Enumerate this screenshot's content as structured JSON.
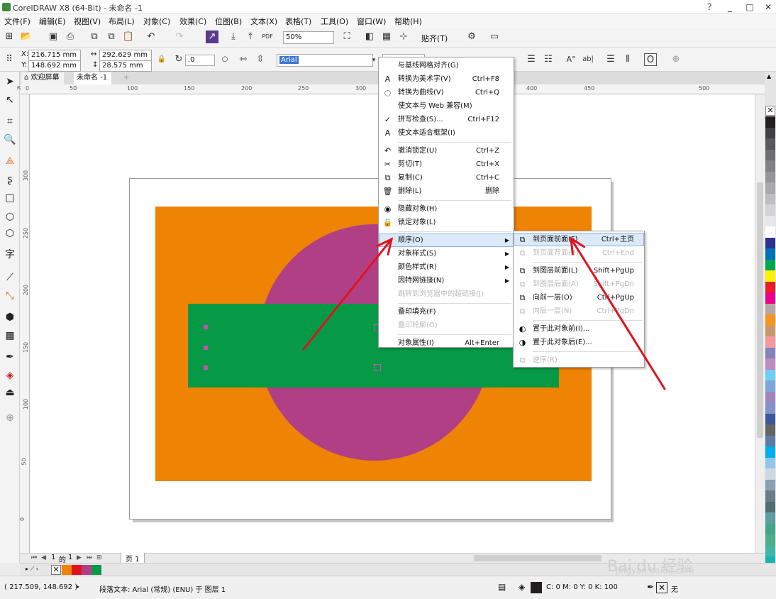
{
  "window": {
    "title": "CorelDRAW X8 (64-Bit) - 未命名 -1",
    "controls": [
      "？",
      "_",
      "□",
      "✕"
    ]
  },
  "menu": [
    "文件(F)",
    "编辑(E)",
    "视图(V)",
    "布局(L)",
    "对象(C)",
    "效果(C)",
    "位图(B)",
    "文本(X)",
    "表格(T)",
    "工具(O)",
    "窗口(W)",
    "帮助(H)"
  ],
  "toolbar": {
    "zoom": "50%",
    "snap_label": "贴齐(T)"
  },
  "propbar": {
    "x_label": "X:",
    "x_value": "216.715 mm",
    "y_label": "Y:",
    "y_value": "148.692 mm",
    "width_value": "292.629 mm",
    "height_value": "28.575 mm",
    "rotation_value": ".0",
    "font_value": "Arial"
  },
  "doc_tabs": [
    "欢迎屏幕",
    "未命名 -1"
  ],
  "ruler_h": [
    "0",
    "50",
    "100",
    "150",
    "200",
    "250",
    "300",
    "350",
    "400",
    "450",
    "500"
  ],
  "ruler_v": [
    "300",
    "250",
    "200",
    "150",
    "100",
    "50",
    "0"
  ],
  "context_menu": [
    {
      "label": "与基线网格对齐(G)",
      "shortcut": "",
      "icon": "",
      "disabled": false
    },
    {
      "label": "转换为美术字(V)",
      "shortcut": "Ctrl+F8",
      "icon": "A",
      "disabled": false
    },
    {
      "label": "转换为曲线(V)",
      "shortcut": "Ctrl+Q",
      "icon": "◌",
      "disabled": false
    },
    {
      "label": "使文本与 Web 兼容(M)",
      "shortcut": "",
      "icon": "",
      "disabled": false
    },
    {
      "label": "拼写检查(S)...",
      "shortcut": "Ctrl+F12",
      "icon": "✓",
      "disabled": false
    },
    {
      "label": "使文本适合框架(I)",
      "shortcut": "",
      "icon": "A",
      "disabled": false
    },
    {
      "label": "撤消锁定(U)",
      "shortcut": "Ctrl+Z",
      "icon": "↶",
      "disabled": false
    },
    {
      "label": "剪切(T)",
      "shortcut": "Ctrl+X",
      "icon": "✂",
      "disabled": false
    },
    {
      "label": "复制(C)",
      "shortcut": "Ctrl+C",
      "icon": "⧉",
      "disabled": false
    },
    {
      "label": "删除(L)",
      "shortcut": "删除",
      "icon": "🗑",
      "disabled": false
    },
    {
      "label": "隐藏对象(H)",
      "shortcut": "",
      "icon": "◉",
      "disabled": false
    },
    {
      "label": "锁定对象(L)",
      "shortcut": "",
      "icon": "🔒",
      "disabled": false
    },
    {
      "label": "顺序(O)",
      "shortcut": "",
      "icon": "",
      "disabled": false,
      "submenu": true,
      "highlighted": true
    },
    {
      "label": "对象样式(S)",
      "shortcut": "",
      "icon": "",
      "disabled": false,
      "submenu": true
    },
    {
      "label": "颜色样式(R)",
      "shortcut": "",
      "icon": "",
      "disabled": false,
      "submenu": true
    },
    {
      "label": "因特网链接(N)",
      "shortcut": "",
      "icon": "",
      "disabled": false,
      "submenu": true
    },
    {
      "label": "跳转到浏览器中的超链接(J)",
      "shortcut": "",
      "icon": "",
      "disabled": true
    },
    {
      "label": "叠印填充(F)",
      "shortcut": "",
      "icon": "",
      "disabled": false
    },
    {
      "label": "叠印轮廓(O)",
      "shortcut": "",
      "icon": "",
      "disabled": true
    },
    {
      "label": "对象属性(I)",
      "shortcut": "Alt+Enter",
      "icon": "",
      "disabled": false
    }
  ],
  "order_submenu": [
    {
      "label": "到页面前面(F)",
      "shortcut": "Ctrl+主页",
      "disabled": false,
      "highlighted": true
    },
    {
      "label": "到页面背面(B)",
      "shortcut": "Ctrl+End",
      "disabled": true
    },
    {
      "label": "到图层前面(L)",
      "shortcut": "Shift+PgUp",
      "disabled": false
    },
    {
      "label": "到图层后面(A)",
      "shortcut": "Shift+PgDn",
      "disabled": true
    },
    {
      "label": "向前一层(O)",
      "shortcut": "Ctrl+PgUp",
      "disabled": false
    },
    {
      "label": "向后一层(N)",
      "shortcut": "Ctrl+PgDn",
      "disabled": true
    },
    {
      "label": "置于此对象前(I)...",
      "shortcut": "",
      "disabled": false
    },
    {
      "label": "置于此对象后(E)...",
      "shortcut": "",
      "disabled": false
    },
    {
      "label": "逆序(R)",
      "shortcut": "",
      "disabled": true
    }
  ],
  "page_nav": {
    "current": "1",
    "of": "的",
    "total": "1",
    "page_tab": "页 1"
  },
  "status": {
    "coords": "( 217.509, 148.692 )",
    "info": "段落文本: Arial (常规) (ENU) 于 图层 1",
    "fill_info": "C: 0 M: 0 Y: 0 K: 100",
    "outline_info": "无"
  },
  "colors": {
    "orange": "#ee8304",
    "magenta": "#b03f86",
    "green": "#069a46",
    "arrow_red": "#e0131c"
  },
  "palette": [
    "#231f20",
    "#414042",
    "#58595b",
    "#6d6e71",
    "#808285",
    "#939598",
    "#a7a9ac",
    "#bcbec0",
    "#d1d3d4",
    "#e6e7e8",
    "#ffffff",
    "#2e3192",
    "#0072bc",
    "#00a651",
    "#fff200",
    "#ed1c24",
    "#ec008c",
    "#b5a6a6",
    "#f7941d",
    "#c49a6c",
    "#f5989d",
    "#8781bd",
    "#bd8cbf",
    "#6dcff6",
    "#7da7d9",
    "#a186be",
    "#8393ca",
    "#3b5998",
    "#636466",
    "#5e7ca3",
    "#00aeef",
    "#92c6e8",
    "#ced8e0",
    "#8aa0b4",
    "#6d7b87",
    "#4f6f6f",
    "#5f9ea0",
    "#45a48a",
    "#4daf89",
    "#3fb6a8",
    "#14b5b1"
  ],
  "watermark": {
    "brand": "Bai du 经验",
    "url": "jingyan.baidu.com"
  }
}
